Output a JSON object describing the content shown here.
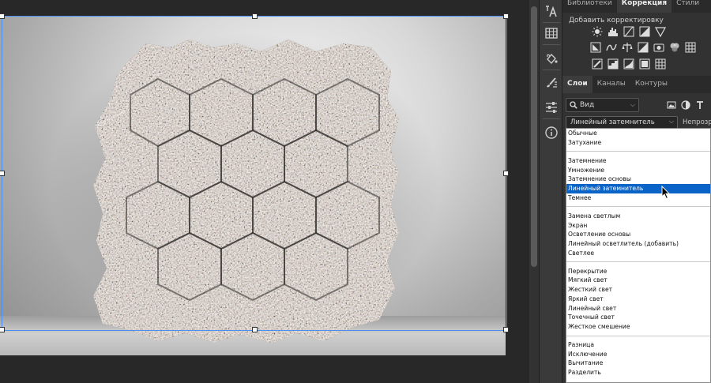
{
  "panel": {
    "top_tabs": [
      "Библиотеки",
      "Коррекция",
      "Стили"
    ],
    "top_tab_active": 1,
    "adjustments_title": "Добавить корректировку",
    "adjustment_icons": [
      [
        "brightness-contrast-icon",
        "levels-icon",
        "curves-icon",
        "exposure-icon",
        "gradient-triangle-icon"
      ],
      [
        "vibrance-icon",
        "hue-saturation-icon",
        "color-balance-icon",
        "black-white-icon",
        "photo-filter-icon",
        "channel-mixer-icon",
        "color-lookup-icon"
      ],
      [
        "invert-icon",
        "posterize-icon",
        "threshold-icon",
        "selective-color-icon",
        "gradient-map-icon"
      ]
    ],
    "layer_tabs": [
      "Слои",
      "Каналы",
      "Контуры"
    ],
    "layer_tab_active": 0,
    "filter_value": "Вид",
    "blend_mode_value": "Линейный затемнитель",
    "opacity_label": "Непрозр"
  },
  "blend_menu": {
    "groups": [
      [
        "Обычные",
        "Затухание"
      ],
      [
        "Затемнение",
        "Умножение",
        "Затемнение основы",
        "Линейный затемнитель",
        "Темнее"
      ],
      [
        "Замена светлым",
        "Экран",
        "Осветление основы",
        "Линейный осветлитель (добавить)",
        "Светлее"
      ],
      [
        "Перекрытие",
        "Мягкий свет",
        "Жесткий свет",
        "Яркий свет",
        "Линейный свет",
        "Точечный свет",
        "Жесткое смешение"
      ],
      [
        "Разница",
        "Исключение",
        "Вычитание",
        "Разделить"
      ]
    ],
    "selected": "Линейный затемнитель"
  },
  "tools": [
    "text-style-icon",
    "grid-icon",
    "paint-bucket-icon",
    "brush-settings-icon",
    "sliders-icon",
    "info-icon"
  ],
  "colors": {
    "selection": "#0a64c8",
    "frame": "#4a8ff0",
    "panel_bg": "#323232"
  }
}
